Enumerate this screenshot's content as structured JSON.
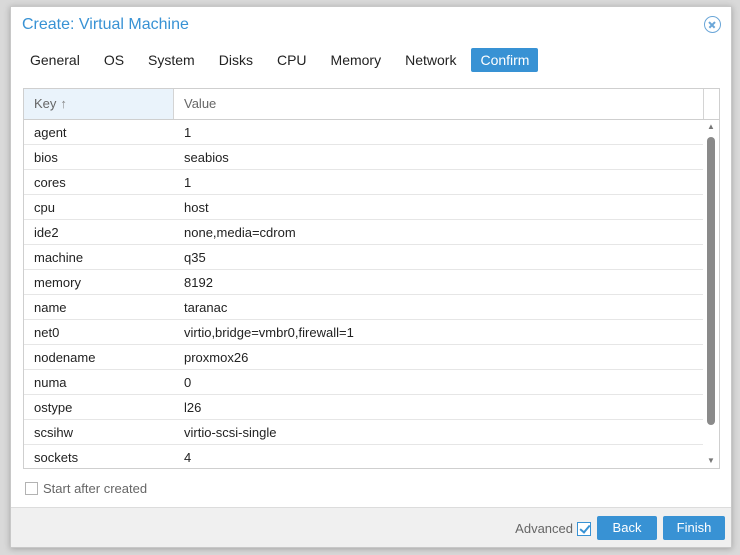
{
  "window": {
    "title": "Create: Virtual Machine"
  },
  "tabs": [
    {
      "label": "General",
      "active": false
    },
    {
      "label": "OS",
      "active": false
    },
    {
      "label": "System",
      "active": false
    },
    {
      "label": "Disks",
      "active": false
    },
    {
      "label": "CPU",
      "active": false
    },
    {
      "label": "Memory",
      "active": false
    },
    {
      "label": "Network",
      "active": false
    },
    {
      "label": "Confirm",
      "active": true
    }
  ],
  "grid": {
    "columns": {
      "key": "Key",
      "value": "Value"
    },
    "sort_icon": "sort-ascending-arrow-icon",
    "rows": [
      {
        "key": "agent",
        "value": "1"
      },
      {
        "key": "bios",
        "value": "seabios"
      },
      {
        "key": "cores",
        "value": "1"
      },
      {
        "key": "cpu",
        "value": "host"
      },
      {
        "key": "ide2",
        "value": "none,media=cdrom"
      },
      {
        "key": "machine",
        "value": "q35"
      },
      {
        "key": "memory",
        "value": "8192"
      },
      {
        "key": "name",
        "value": "taranac"
      },
      {
        "key": "net0",
        "value": "virtio,bridge=vmbr0,firewall=1"
      },
      {
        "key": "nodename",
        "value": "proxmox26"
      },
      {
        "key": "numa",
        "value": "0"
      },
      {
        "key": "ostype",
        "value": "l26"
      },
      {
        "key": "scsihw",
        "value": "virtio-scsi-single"
      },
      {
        "key": "sockets",
        "value": "4"
      }
    ]
  },
  "start_after_created": {
    "label": "Start after created",
    "checked": false
  },
  "footer": {
    "advanced_label": "Advanced",
    "advanced_checked": true,
    "back_label": "Back",
    "finish_label": "Finish"
  },
  "colors": {
    "accent": "#3892d4",
    "footer_bg": "#f0f0f0"
  }
}
